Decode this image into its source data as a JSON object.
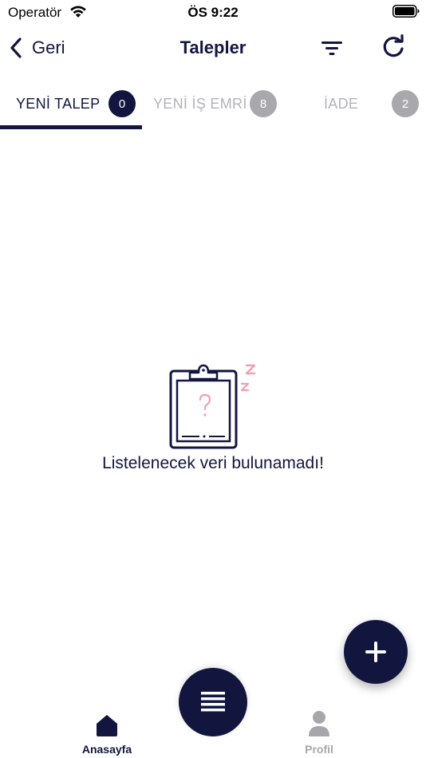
{
  "status_bar": {
    "carrier": "Operatör",
    "time": "ÖS 9:22"
  },
  "nav": {
    "back_label": "Geri",
    "title": "Talepler"
  },
  "tabs": [
    {
      "label": "YENİ TALEP",
      "count": "0",
      "active": true
    },
    {
      "label": "YENİ İŞ EMRİ",
      "count": "8",
      "active": false
    },
    {
      "label": "İADE",
      "count": "2",
      "active": false
    }
  ],
  "empty_state": {
    "message": "Listelenecek veri bulunamadı!",
    "icon": "clipboard-question-icon"
  },
  "bottom_nav": {
    "home_label": "Anasayfa",
    "profile_label": "Profil"
  },
  "colors": {
    "primary": "#12163f",
    "inactive_text": "#b3b3b8",
    "inactive_badge": "#a9a9ad",
    "accent_pink": "#f2a0b0"
  }
}
